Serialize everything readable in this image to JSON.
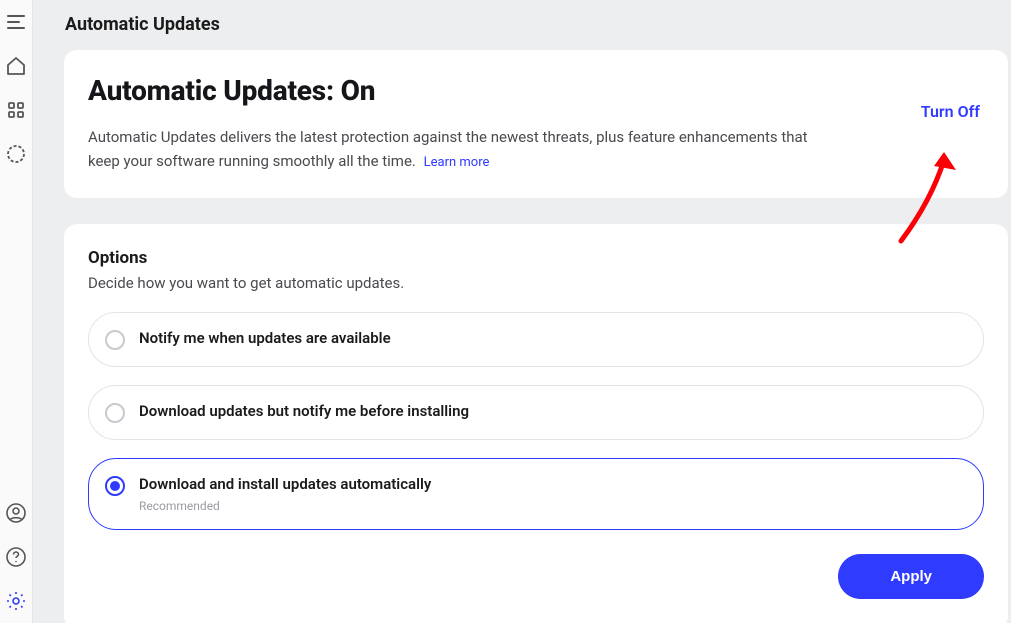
{
  "page": {
    "title": "Automatic Updates"
  },
  "status": {
    "heading": "Automatic Updates: On",
    "description": "Automatic Updates delivers the latest protection against the newest threats, plus feature enhancements that keep your software running smoothly all the time.",
    "learn_more": "Learn more",
    "toggle_label": "Turn Off"
  },
  "options": {
    "title": "Options",
    "subtitle": "Decide how you want to get automatic updates.",
    "items": [
      {
        "label": "Notify me when updates are available",
        "note": "",
        "selected": false
      },
      {
        "label": "Download updates but notify me before installing",
        "note": "",
        "selected": false
      },
      {
        "label": "Download and install updates automatically",
        "note": "Recommended",
        "selected": true
      }
    ],
    "apply_label": "Apply"
  },
  "sidebar": {
    "top": [
      {
        "name": "menu-icon"
      },
      {
        "name": "home-icon"
      },
      {
        "name": "apps-icon"
      },
      {
        "name": "circle-icon"
      }
    ],
    "bottom": [
      {
        "name": "user-icon"
      },
      {
        "name": "help-icon"
      },
      {
        "name": "settings-icon",
        "active": true
      }
    ]
  },
  "colors": {
    "accent": "#2f3bff",
    "annotation": "#fb0007"
  }
}
